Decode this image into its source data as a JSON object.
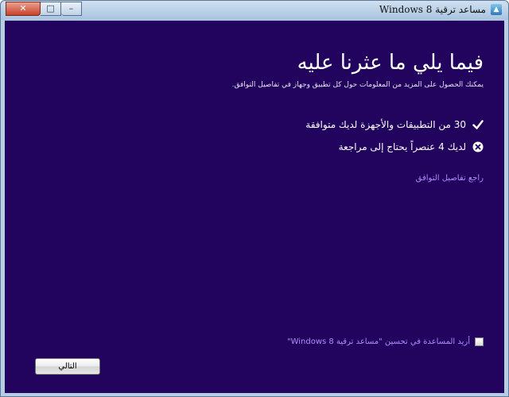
{
  "window": {
    "title": "مساعد ترقية Windows 8",
    "app_icon": "upgrade-assistant-icon",
    "controls": {
      "close": "✕",
      "maximize": "□",
      "minimize": "–"
    }
  },
  "main": {
    "heading": "فيما يلي ما عثرنا عليه",
    "subtext": "يمكنك الحصول على المزيد من المعلومات حول كل تطبيق وجهاز في تفاصيل التوافق.",
    "results": [
      {
        "icon": "checkmark-icon",
        "text": "30 من التطبيقات والأجهزة لديك متوافقة"
      },
      {
        "icon": "error-circle-icon",
        "text": "لديك 4 عنصراً يحتاج إلى مراجعة"
      }
    ],
    "details_link": "راجع تفاصيل التوافق",
    "help_checkbox": {
      "label": "أريد المساعدة في تحسين \"مساعد ترقية Windows 8\"",
      "checked": false
    }
  },
  "footer": {
    "next_label": "التالي"
  },
  "colors": {
    "background": "#22035e",
    "link": "#b08cff",
    "text": "#ffffff"
  }
}
